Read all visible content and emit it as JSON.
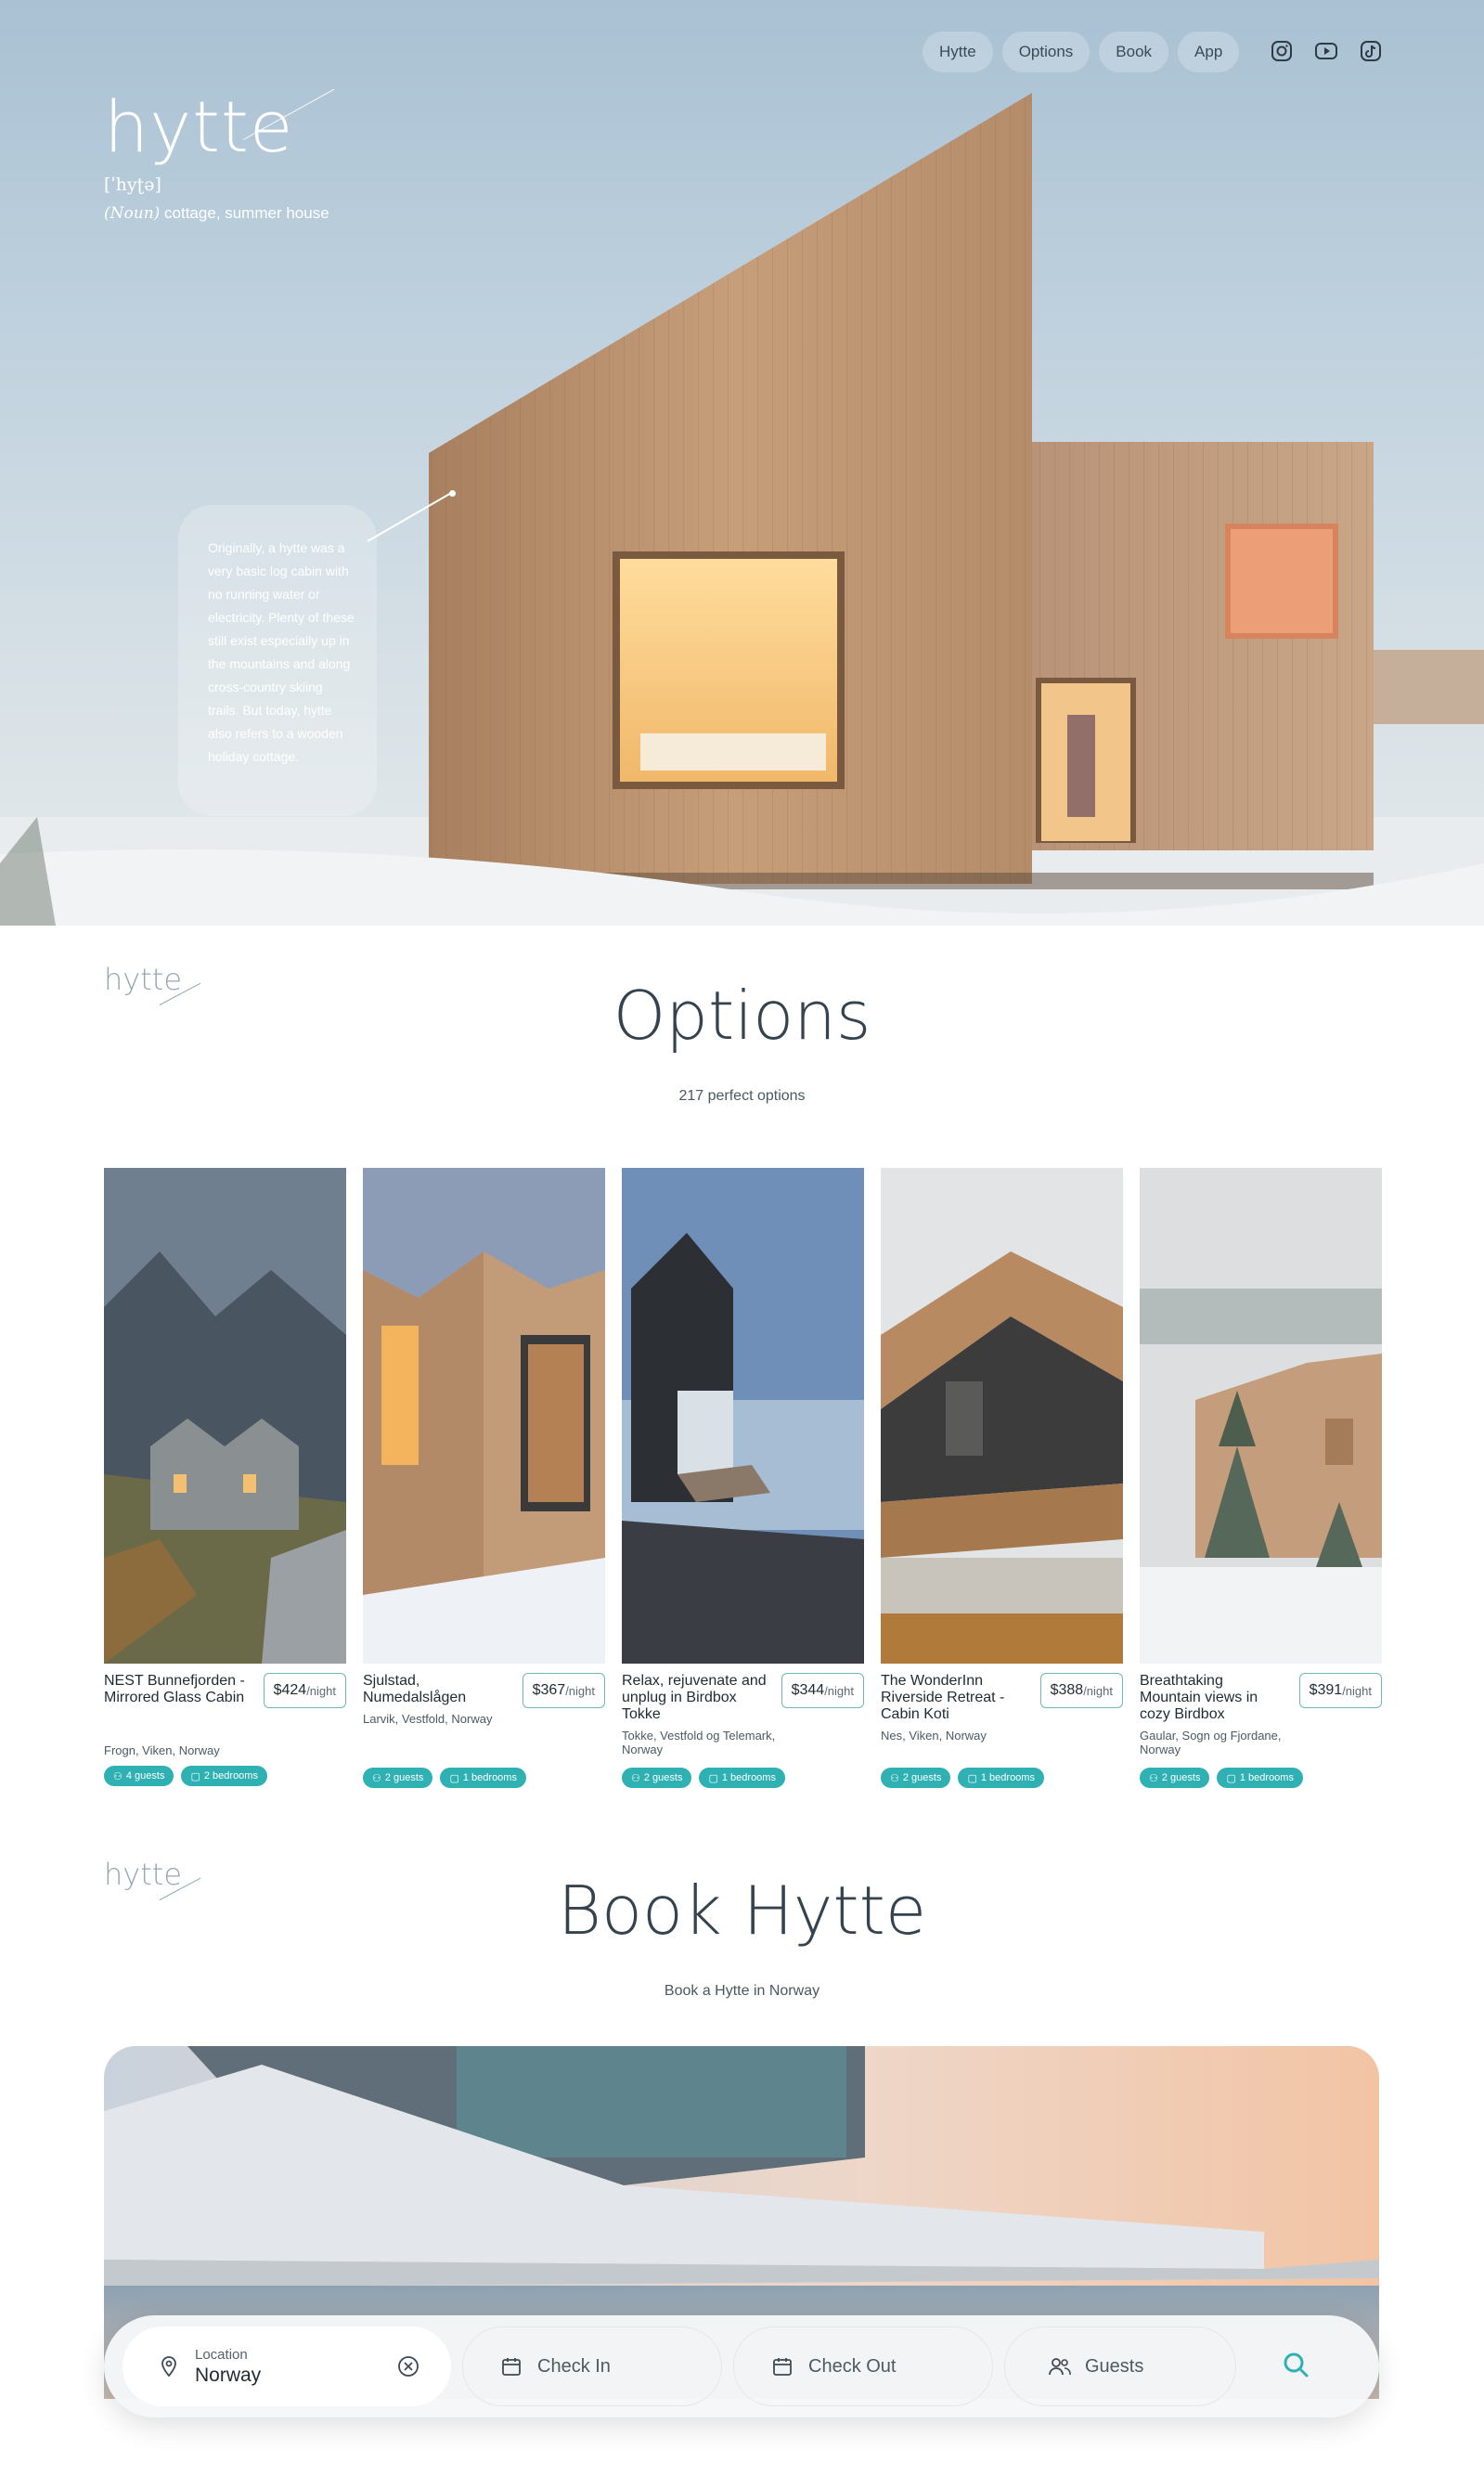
{
  "nav": {
    "items": [
      {
        "label": "Hytte"
      },
      {
        "label": "Options"
      },
      {
        "label": "Book"
      },
      {
        "label": "App"
      }
    ],
    "social": [
      "instagram-icon",
      "youtube-icon",
      "tiktok-icon"
    ]
  },
  "hero": {
    "word": "hytte",
    "phonetic": "[ˈhyʈə]",
    "pos": "(Noun)",
    "definition": "cottage, summer house",
    "story": "Originally, a hytte was a very basic log cabin with no running water or electricity. Plenty of these still exist especially up in the mountains and along cross-country skiing trails. But today, hytte also refers to a wooden holiday cottage."
  },
  "options": {
    "mini_logo": "hytte",
    "title": "Options",
    "subtitle": "217 perfect options",
    "cards": [
      {
        "name": "NEST Bunnefjorden - Mirrored Glass Cabin",
        "price": "$424",
        "unit": "/night",
        "location": "Frogn, Viken, Norway",
        "guests": "4 guests",
        "bedrooms": "2 bedrooms"
      },
      {
        "name": "Sjulstad, Numedalslågen",
        "price": "$367",
        "unit": "/night",
        "location": "Larvik, Vestfold, Norway",
        "guests": "2 guests",
        "bedrooms": "1 bedrooms"
      },
      {
        "name": "Relax, rejuvenate and unplug in Birdbox Tokke",
        "price": "$344",
        "unit": "/night",
        "location": "Tokke, Vestfold og Telemark, Norway",
        "guests": "2 guests",
        "bedrooms": "1 bedrooms"
      },
      {
        "name": "The WonderInn Riverside Retreat - Cabin Koti",
        "price": "$388",
        "unit": "/night",
        "location": "Nes, Viken, Norway",
        "guests": "2 guests",
        "bedrooms": "1 bedrooms"
      },
      {
        "name": "Breathtaking Mountain views in cozy Birdbox",
        "price": "$391",
        "unit": "/night",
        "location": "Gaular, Sogn og Fjordane, Norway",
        "guests": "2 guests",
        "bedrooms": "1 bedrooms"
      }
    ]
  },
  "book": {
    "mini_logo": "hytte",
    "title": "Book Hytte",
    "subtitle": "Book a Hytte in Norway",
    "location_label": "Location",
    "location_value": "Norway",
    "check_in": "Check In",
    "check_out": "Check Out",
    "guests": "Guests"
  },
  "colors": {
    "accent": "#2fb0b3",
    "text": "#34434d",
    "price_border": "#6fb5b9"
  }
}
